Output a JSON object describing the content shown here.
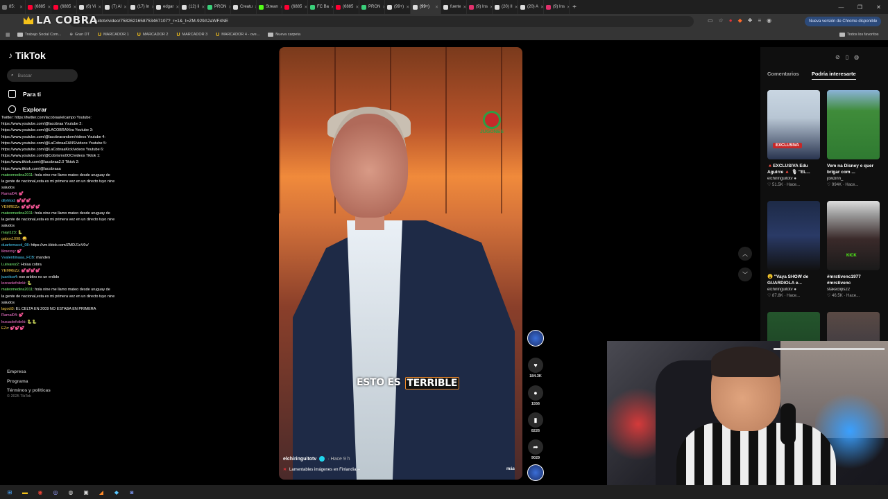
{
  "browser": {
    "tabs": [
      {
        "label": "85:",
        "color": "#777"
      },
      {
        "label": "(6885",
        "color": "#ff0033"
      },
      {
        "label": "(6885",
        "color": "#ff0033"
      },
      {
        "label": "(6) Vi",
        "color": "#ddd"
      },
      {
        "label": "(7) Al",
        "color": "#ddd"
      },
      {
        "label": "(17) In",
        "color": "#ddd"
      },
      {
        "label": "edgar",
        "color": "#ddd"
      },
      {
        "label": "(12) Ii",
        "color": "#ddd"
      },
      {
        "label": "PRON",
        "color": "#3ad07a"
      },
      {
        "label": "Creatu",
        "color": "#ddd"
      },
      {
        "label": "Strean",
        "color": "#53fc18"
      },
      {
        "label": "(6885",
        "color": "#ff0033"
      },
      {
        "label": "FC Ba",
        "color": "#3ad07a"
      },
      {
        "label": "(6885",
        "color": "#ff0033"
      },
      {
        "label": "PRON",
        "color": "#3ad07a"
      },
      {
        "label": "(99+)",
        "color": "#ddd"
      },
      {
        "label": "(99+)",
        "color": "#ddd",
        "active": true
      },
      {
        "label": "fuerte",
        "color": "#ddd"
      },
      {
        "label": "(9) Ins",
        "color": "#e1306c"
      },
      {
        "label": "(20) II",
        "color": "#ddd"
      },
      {
        "label": "(20) A",
        "color": "#ddd"
      },
      {
        "label": "(9) Ins",
        "color": "#e1306c"
      }
    ],
    "new_tab": "+",
    "window_controls": [
      "—",
      "❐",
      "✕"
    ],
    "url": "inguitotv/video/7582621658753467107?_r=1&_t=ZM-929A2aWF4NE",
    "chrome_update": "Nueva versión de Chrome disponible",
    "bookmarks": [
      {
        "label": "Trabajo Social Com...",
        "icon": "folder-icon"
      },
      {
        "label": "Gran DT",
        "icon": "globe-icon"
      },
      {
        "label": "MARCADOR 1",
        "icon": "u-icon"
      },
      {
        "label": "MARCADOR 2",
        "icon": "u-icon"
      },
      {
        "label": "MARCADOR 3",
        "icon": "u-icon"
      },
      {
        "label": "MARCADOR 4 - ove...",
        "icon": "u-icon"
      },
      {
        "label": "Nueva carpeta",
        "icon": "folder-icon"
      }
    ],
    "all_favorites": "Todos los favoritos"
  },
  "overlay": {
    "brand": "LA COBRA"
  },
  "tiktok": {
    "logo": "TikTok",
    "search_placeholder": "Buscar",
    "nav": [
      {
        "label": "Para ti",
        "icon": "home-icon"
      },
      {
        "label": "Explorar",
        "icon": "compass-icon"
      }
    ],
    "footer_links": [
      "Empresa",
      "Programa",
      "Términos y políticas"
    ],
    "copyright": "© 2025 TikTok",
    "video": {
      "author": "elchiringuitotv",
      "time": "· Hace 9 h",
      "description": "Lamentables imágenes en Finlandia.--",
      "more": "más",
      "caption_pre": "ESTO ES",
      "caption_hl": "TERRIBLE",
      "watermark": "JUGONES"
    },
    "actions": [
      {
        "icon": "heart-icon",
        "glyph": "♥",
        "count": "184.3K"
      },
      {
        "icon": "comment-icon",
        "glyph": "●",
        "count": "1556"
      },
      {
        "icon": "bookmark-icon",
        "glyph": "▮",
        "count": "8226"
      },
      {
        "icon": "share-icon",
        "glyph": "➦",
        "count": "9029"
      }
    ],
    "right_tabs": [
      "Comentarios",
      "Podría interesarte"
    ],
    "cards": [
      {
        "title": "🔺EXCLUSIVA Edu Aguirre 🔺 🎙 \"EL...",
        "author": "elchiringuitotv ●",
        "meta": "♡ 51.5K · Hace...",
        "badge": "EXCLUSIVA"
      },
      {
        "title": "Vem na Disney e quer brigar com ...",
        "author": "jowzinn_",
        "meta": "♡ 994K · Hace..."
      },
      {
        "title": "😮 \"Vaya SHOW de GUARDIOLA e...",
        "author": "elchiringuitotv ●",
        "meta": "♡ 87.8K · Hace..."
      },
      {
        "title": "#mrstivenc1977 #mrstivenc",
        "author": "stakeclips22",
        "meta": "♡ 46.5K · Hace...",
        "badge": "KICK"
      },
      {
        "title": "",
        "author": "",
        "meta": ""
      },
      {
        "title": "",
        "author": "",
        "meta": ""
      }
    ]
  },
  "chat": [
    {
      "u": "",
      "t": "Twitter: https://twitter.com/lacobraa/elcampo Youtube:"
    },
    {
      "u": "",
      "t": "https://www.youtube.com/@lacobraa Youtube 2:"
    },
    {
      "u": "",
      "t": "https://www.youtube.com/@LACOBRAXtra Youtube 3:"
    },
    {
      "u": "",
      "t": "https://www.youtube.com/@lacobrarandom/videos Youtube 4:"
    },
    {
      "u": "",
      "t": "https://www.youtube.com/@LaCobraaFANS/videos Youtube 5:"
    },
    {
      "u": "",
      "t": "https://www.youtube.com/@LaCobraaKick/videos Youtube 6:"
    },
    {
      "u": "",
      "t": "https://www.youtube.com/@Cobrismo0OC/videos Tiktok 1:"
    },
    {
      "u": "",
      "t": "https://www.tiktok.com/@lacobraa2.0 Tiktok 2:"
    },
    {
      "u": "",
      "t": "https://www.tiktok.com/@lacobraaa"
    },
    {
      "u": "mateomedina2011",
      "c": "u2",
      "t": ": hola nine me llamo mateo desde uruguay de"
    },
    {
      "u": "",
      "t": "la gente de nacional,esta es mi primera vez en un directo tuyo nine"
    },
    {
      "u": "",
      "t": "saludos"
    },
    {
      "u": "Ramal04",
      "c": "u3",
      "t": ": 💕"
    },
    {
      "u": "dilyhtod",
      "c": "u1",
      "t": ": 💕💕💕"
    },
    {
      "u": "YEMREZz",
      "c": "u4",
      "t": ": 💕💕💕💕"
    },
    {
      "u": "mateomedina2011",
      "c": "u2",
      "t": ": hola nine me llamo mateo desde uruguay de"
    },
    {
      "u": "",
      "t": "la gente de nacional,esta es mi primera vez en un directo tuyo nine"
    },
    {
      "u": "",
      "t": "saludos"
    },
    {
      "u": "mayi123",
      "c": "u2",
      "t": ": 🐍"
    },
    {
      "u": "gabox1098",
      "c": "u4",
      "t": ": 😀"
    },
    {
      "u": "duartemacol_08",
      "c": "u1",
      "t": ": https://vm.tiktok.com/ZMDJ1cV6v/"
    },
    {
      "u": "liknexxy",
      "c": "u3",
      "t": ": 💕"
    },
    {
      "u": "Vvalentiinaaa_FCB",
      "c": "u1",
      "t": ": manden"
    },
    {
      "u": "Luiivarez2",
      "c": "u2",
      "t": ": Holaa cobra"
    },
    {
      "u": "YEMREZz",
      "c": "u4",
      "t": ": 💕💕💕💕"
    },
    {
      "u": "juanitoa4",
      "c": "u1",
      "t": ": ese arbitro es un erdido"
    },
    {
      "u": "lezcaolefolinki",
      "c": "u3",
      "t": ": 🐍"
    },
    {
      "u": "mateomedina2011",
      "c": "u2",
      "t": ": hola nine me llamo mateo desde uruguay de"
    },
    {
      "u": "",
      "t": "la gente de nacional,esta es mi primera vez en un directo tuyo nine"
    },
    {
      "u": "",
      "t": "saludos"
    },
    {
      "u": "lagodi3",
      "c": "u4",
      "t": ": EL CELTA EN 2009 NO ESTABA EN PRIMERA"
    },
    {
      "u": "Ramal04",
      "c": "u3",
      "t": ": 💕"
    },
    {
      "u": "lezcaolefolinki",
      "c": "u3",
      "t": ": 🐍🐍"
    },
    {
      "u": "EZz",
      "c": "u4",
      "t": ": 💕💕💕"
    }
  ],
  "taskbar": [
    {
      "icon": "windows-icon",
      "glyph": "⊞",
      "color": "#4aa8ff"
    },
    {
      "icon": "files-icon",
      "glyph": "▬",
      "color": "#f5c21a"
    },
    {
      "icon": "chrome-icon",
      "glyph": "◉",
      "color": "#ea4335"
    },
    {
      "icon": "app-icon",
      "glyph": "◎",
      "color": "#9aa0ff"
    },
    {
      "icon": "obs-icon",
      "glyph": "◍",
      "color": "#ddd"
    },
    {
      "icon": "app2-icon",
      "glyph": "▣",
      "color": "#ddd"
    },
    {
      "icon": "app3-icon",
      "glyph": "◢",
      "color": "#ff8a2a"
    },
    {
      "icon": "app4-icon",
      "glyph": "◆",
      "color": "#5ac8ff"
    },
    {
      "icon": "discord-icon",
      "glyph": "◙",
      "color": "#7289da"
    }
  ]
}
